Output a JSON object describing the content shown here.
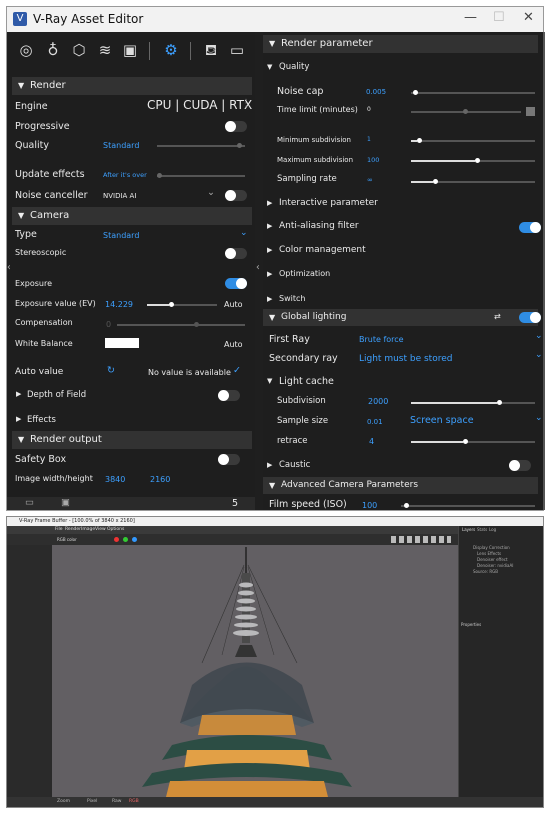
{
  "window": {
    "title": "V-Ray Asset Editor",
    "icon_letter": "V",
    "minimize": "—",
    "maximize": "☐",
    "close": "✕"
  },
  "toolbar": {
    "icons": [
      "materials-icon",
      "lights-icon",
      "geometry-icon",
      "layers-icon",
      "textures-icon",
      "settings-icon",
      "render-teapot-icon",
      "frame-buffer-icon"
    ]
  },
  "left": {
    "render_header": "Render",
    "engine_label": "Engine",
    "engine_value": "CPU | CUDA | RTX",
    "progressive_label": "Progressive",
    "quality_label": "Quality",
    "quality_value": "Standard",
    "update_effects_label": "Update effects",
    "update_effects_value": "After it's over",
    "noise_canceller_label": "Noise canceller",
    "noise_canceller_value": "NVIDIA AI",
    "camera_header": "Camera",
    "type_label": "Type",
    "type_value": "Standard",
    "stereoscopic_label": "Stereoscopic",
    "exposure_label": "Exposure",
    "exposure_value_label": "Exposure value (EV)",
    "exposure_value": "14.229",
    "exposure_auto": "Auto",
    "compensation_label": "Compensation",
    "compensation_value": "0",
    "white_balance_label": "White Balance",
    "white_balance_auto": "Auto",
    "auto_value_label": "Auto value",
    "auto_value_text": "No value is available",
    "dof_label": "Depth of Field",
    "effects_label": "Effects",
    "render_output_header": "Render output",
    "safety_box_label": "Safety Box",
    "image_wh_label": "Image width/height",
    "image_width": "3840",
    "image_height": "2160",
    "footer_count": "5"
  },
  "right": {
    "render_parameter_header": "Render parameter",
    "quality_header": "Quality",
    "noise_cap_label": "Noise cap",
    "noise_cap_value": "0.005",
    "time_limit_label": "Time limit (minutes)",
    "time_limit_value": "0",
    "min_subdiv_label": "Minimum subdivision",
    "min_subdiv_value": "1",
    "max_subdiv_label": "Maximum subdivision",
    "max_subdiv_value": "100",
    "sampling_rate_label": "Sampling rate",
    "sampling_rate_value": "∞",
    "interactive_param": "Interactive parameter",
    "anti_aliasing": "Anti-aliasing filter",
    "color_management": "Color management",
    "optimization": "Optimization",
    "switch": "Switch",
    "global_lighting_header": "Global lighting",
    "first_ray_label": "First Ray",
    "first_ray_value": "Brute force",
    "secondary_ray_label": "Secondary ray",
    "secondary_ray_value": "Light must be stored",
    "light_cache_header": "Light cache",
    "subdivision_label": "Subdivision",
    "subdivision_value": "2000",
    "sample_size_label": "Sample size",
    "sample_size_value": "0.01",
    "sample_size_mode": "Screen space",
    "retrace_label": "retrace",
    "retrace_value": "4",
    "caustic_label": "Caustic",
    "adv_camera_header": "Advanced Camera Parameters",
    "film_speed_label": "Film speed (ISO)",
    "film_speed_value": "100"
  },
  "colors": {
    "accent": "#3da0ff",
    "toggle_on": "#2f8de4",
    "panel": "#1e1e1e",
    "header": "#323232"
  },
  "frame_buffer": {
    "title": "V-Ray Frame Buffer - [100.0% of 3840 x 2160]",
    "menu": [
      "File",
      "Render",
      "Image",
      "View",
      "Options"
    ],
    "channel": "RGB color",
    "panel_tabs": [
      "Layers",
      "Stats",
      "Log"
    ],
    "layer_items": [
      "Display Correction",
      "Lens Effects",
      "Denoiser effect",
      "Denoiser: nvidiaAI",
      "Source: RGB"
    ],
    "properties_label": "Properties",
    "status_items": [
      "Zoom",
      "Pixel",
      "Raw",
      "RGB"
    ]
  }
}
